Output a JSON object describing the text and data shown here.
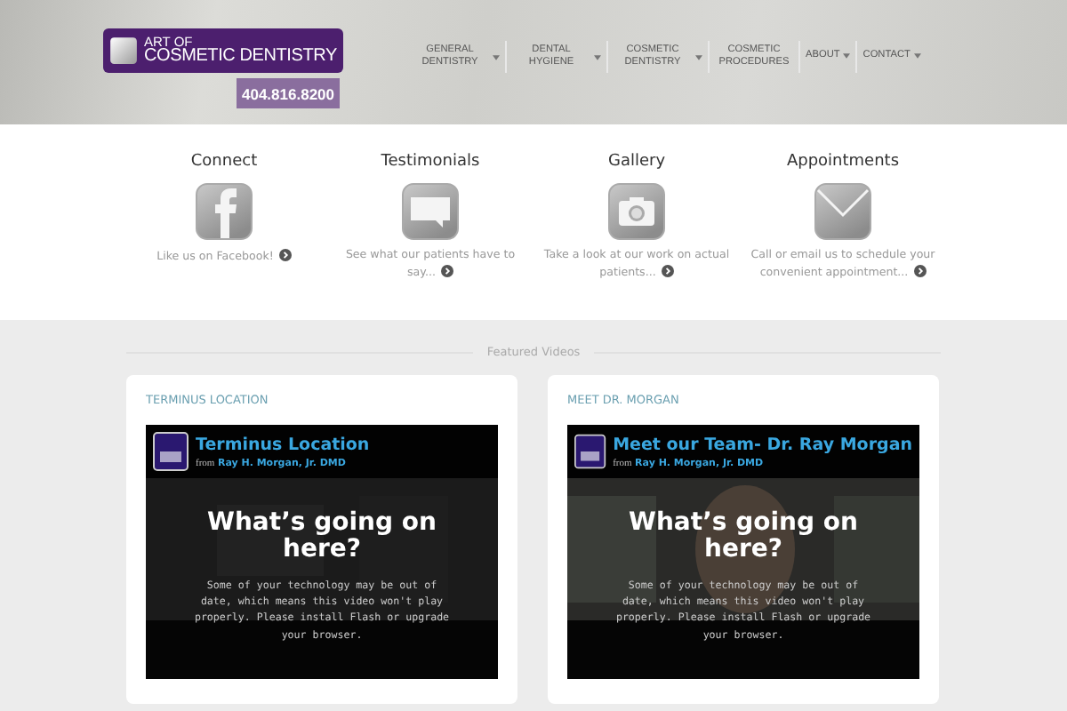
{
  "header": {
    "logo": {
      "line_1": "ART OF",
      "line_2": "COSMETIC DENTISTRY"
    },
    "phone": "404.816.8200",
    "nav": [
      {
        "label": "GENERAL DENTISTRY",
        "dropdown": true
      },
      {
        "label": "DENTAL HYGIENE",
        "dropdown": true
      },
      {
        "label": "COSMETIC DENTISTRY",
        "dropdown": true
      },
      {
        "label": "COSMETIC PROCEDURES",
        "dropdown": false
      },
      {
        "label": "ABOUT",
        "dropdown": true
      },
      {
        "label": "CONTACT",
        "dropdown": true
      }
    ]
  },
  "features": [
    {
      "title": "Connect",
      "kind": "facebook",
      "text": "Like us on Facebook!"
    },
    {
      "title": "Testimonials",
      "kind": "speech",
      "text": "See what our patients have to say..."
    },
    {
      "title": "Gallery",
      "kind": "camera",
      "text": "Take a look at our work on actual patients..."
    },
    {
      "title": "Appointments",
      "kind": "envelope",
      "text": "Call or email us to schedule your convenient appointment..."
    }
  ],
  "featured_videos": {
    "heading": "Featured Videos",
    "videos": [
      {
        "label": "TERMINUS LOCATION",
        "title": "Terminus Location",
        "from": "from",
        "author": "Ray H. Morgan, Jr. DMD",
        "message_title": "What’s going on here?",
        "message": "Some of your technology may be out of date, which means this video won't play properly. Please install Flash or upgrade your browser."
      },
      {
        "label": "MEET DR. MORGAN",
        "title": "Meet our Team- Dr. Ray Morgan",
        "from": "from",
        "author": "Ray H. Morgan, Jr. DMD",
        "message_title": "What’s going on here?",
        "message": "Some of your technology may be out of date, which means this video won't play properly. Please install Flash or upgrade your browser."
      }
    ]
  }
}
